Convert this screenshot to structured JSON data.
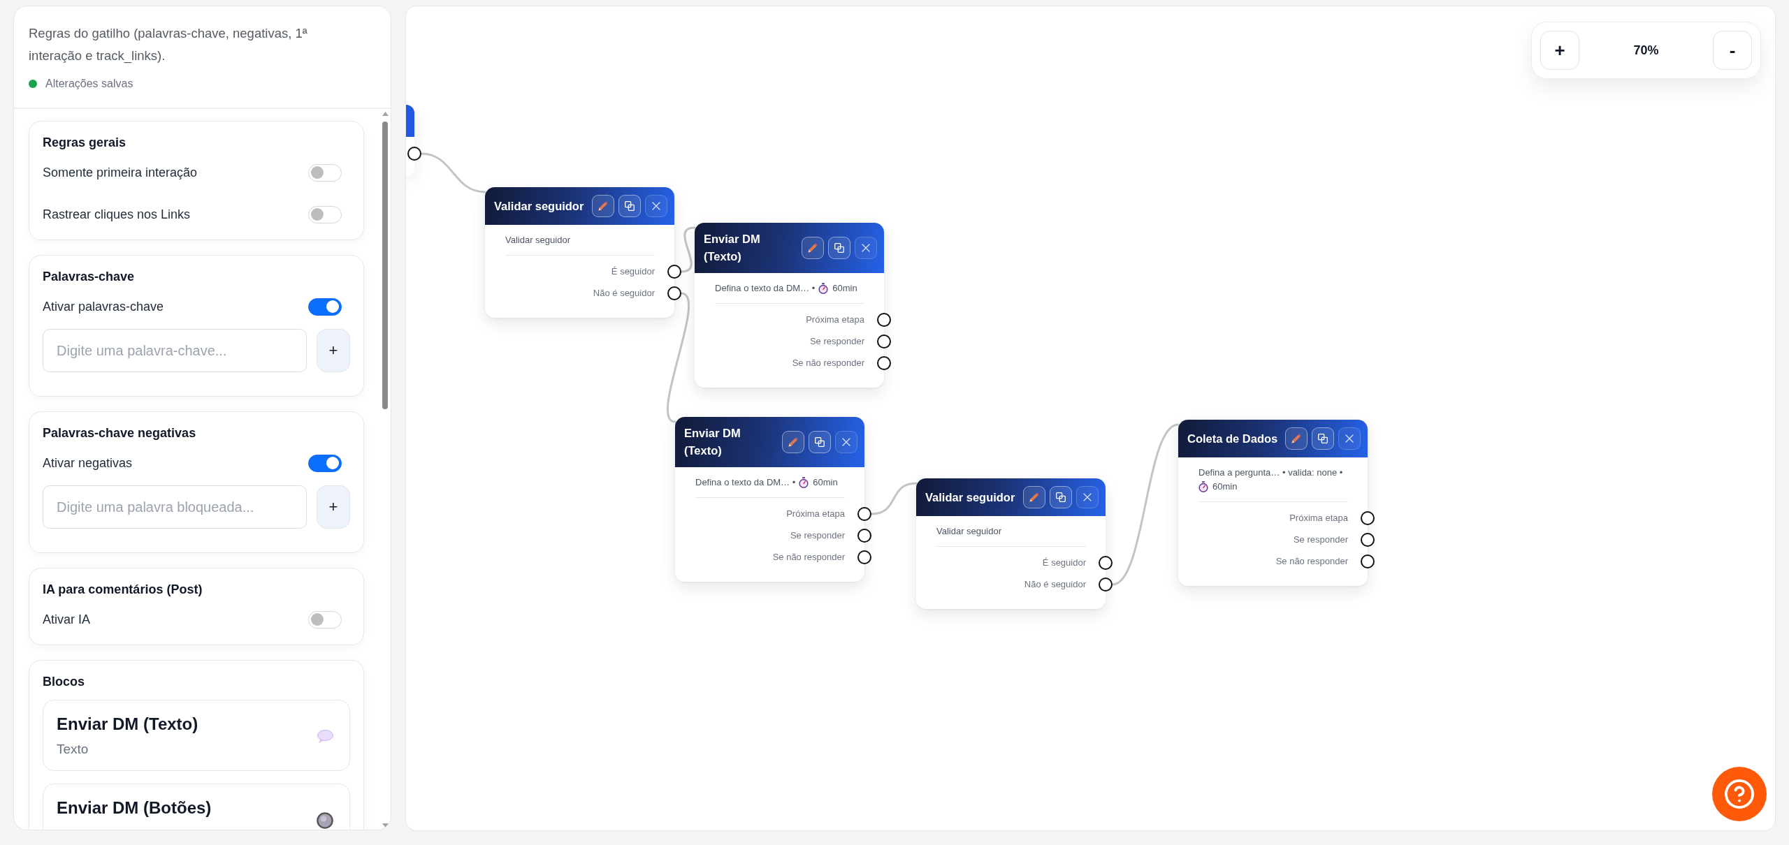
{
  "sidebar": {
    "description": "Regras do gatilho (palavras-chave, negativas, 1ª interação e track_links).",
    "save_status": {
      "label": "Alterações salvas",
      "saved": true
    },
    "sections": [
      {
        "kind": "toggles",
        "title": "Regras gerais",
        "toggles": [
          {
            "label": "Somente primeira interação",
            "on": false
          },
          {
            "label": "Rastrear cliques nos Links",
            "on": false
          }
        ]
      },
      {
        "kind": "keywords",
        "title": "Palavras-chave",
        "toggles": [
          {
            "label": "Ativar palavras-chave",
            "on": true
          }
        ],
        "input": {
          "placeholder": "Digite uma palavra-chave...",
          "add_button": "+"
        }
      },
      {
        "kind": "keywords",
        "title": "Palavras-chave negativas",
        "toggles": [
          {
            "label": "Ativar negativas",
            "on": true
          }
        ],
        "input": {
          "placeholder": "Digite uma palavra bloqueada...",
          "add_button": "+"
        }
      },
      {
        "kind": "toggles",
        "title": "IA para comentários (Post)",
        "toggles": [
          {
            "label": "Ativar IA",
            "on": false
          }
        ]
      },
      {
        "kind": "blocks",
        "title": "Blocos",
        "blocks": [
          {
            "kind": "text",
            "title": "Enviar DM (Texto)",
            "subtitle": "Texto"
          },
          {
            "kind": "buttons",
            "title": "Enviar DM (Botões)"
          }
        ]
      }
    ]
  },
  "canvas": {
    "nodes": [
      {
        "kind": "partial",
        "outputs": [
          {
            "connected": true
          }
        ]
      },
      {
        "kind": "step",
        "title": "Validar seguidor",
        "summary": "Validar seguidor",
        "outputs": [
          {
            "label": "É seguidor",
            "connected": true
          },
          {
            "label": "Não é seguidor",
            "connected": true
          }
        ]
      },
      {
        "kind": "step",
        "title": "Enviar DM (Texto)",
        "summary": "Defina o texto da DM… •",
        "timeout": "60min",
        "outputs": [
          {
            "label": "Próxima etapa",
            "connected": false
          },
          {
            "label": "Se responder",
            "connected": false
          },
          {
            "label": "Se não responder",
            "connected": false
          }
        ]
      },
      {
        "kind": "step",
        "title": "Enviar DM (Texto)",
        "summary": "Defina o texto da DM… •",
        "timeout": "60min",
        "outputs": [
          {
            "label": "Próxima etapa",
            "connected": true
          },
          {
            "label": "Se responder",
            "connected": false
          },
          {
            "label": "Se não responder",
            "connected": false
          }
        ]
      },
      {
        "kind": "step",
        "title": "Validar seguidor",
        "summary": "Validar seguidor",
        "outputs": [
          {
            "label": "É seguidor",
            "connected": false
          },
          {
            "label": "Não é seguidor",
            "connected": true
          }
        ]
      },
      {
        "kind": "step",
        "title": "Coleta de Dados",
        "summary": "Defina a pergunta… • valida: none •",
        "timeout": "60min",
        "outputs": [
          {
            "label": "Próxima etapa",
            "connected": false
          },
          {
            "label": "Se responder",
            "connected": false
          },
          {
            "label": "Se não responder",
            "connected": false
          }
        ]
      }
    ],
    "zoom": {
      "zoom_in": "+",
      "zoom_label": "70%",
      "zoom_out": "-"
    }
  }
}
